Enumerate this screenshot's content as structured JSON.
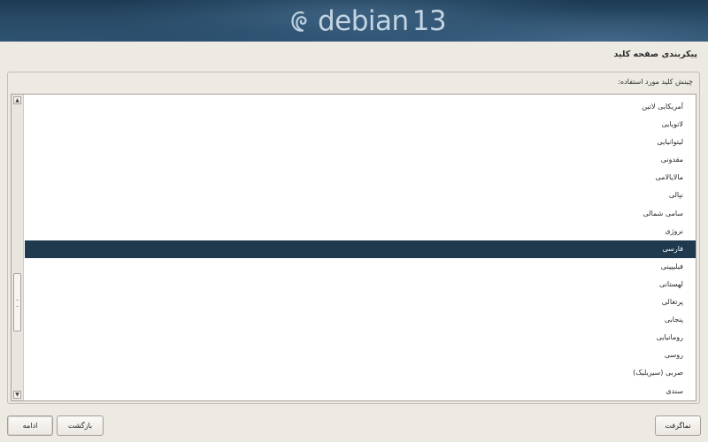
{
  "banner": {
    "logo_word": "debian",
    "logo_version": "13"
  },
  "page": {
    "title": "پیکربندی صفحه کلید"
  },
  "panel": {
    "prompt": "چینش کلید مورد استفاده:"
  },
  "keymap_list": {
    "selected": "فارسی",
    "items": [
      {
        "label": "آمریکایی لاتین",
        "selected": false
      },
      {
        "label": "لاتویایی",
        "selected": false
      },
      {
        "label": "لیتوانیایی",
        "selected": false
      },
      {
        "label": "مقدونی",
        "selected": false
      },
      {
        "label": "مالایالامی",
        "selected": false
      },
      {
        "label": "نپالی",
        "selected": false
      },
      {
        "label": "سامی شمالی",
        "selected": false
      },
      {
        "label": "نروژی",
        "selected": false
      },
      {
        "label": "فارسی",
        "selected": true
      },
      {
        "label": "فیلیپینی",
        "selected": false
      },
      {
        "label": "لهستانی",
        "selected": false
      },
      {
        "label": "پرتغالی",
        "selected": false
      },
      {
        "label": "پنجابی",
        "selected": false
      },
      {
        "label": "رومانیایی",
        "selected": false
      },
      {
        "label": "روسی",
        "selected": false
      },
      {
        "label": "صربی (سیریلیک)",
        "selected": false
      },
      {
        "label": "سندی",
        "selected": false
      }
    ]
  },
  "buttons": {
    "continue": "ادامه",
    "back": "بازگشت",
    "screenshot": "نماگرفت"
  },
  "colors": {
    "banner": "#294a66",
    "selection": "#1f3a4e",
    "background": "#ede9e3"
  },
  "icons": {
    "logo": "debian-swirl-icon",
    "scroll_up": "scroll-up-arrow-icon",
    "scroll_down": "scroll-down-arrow-icon"
  }
}
